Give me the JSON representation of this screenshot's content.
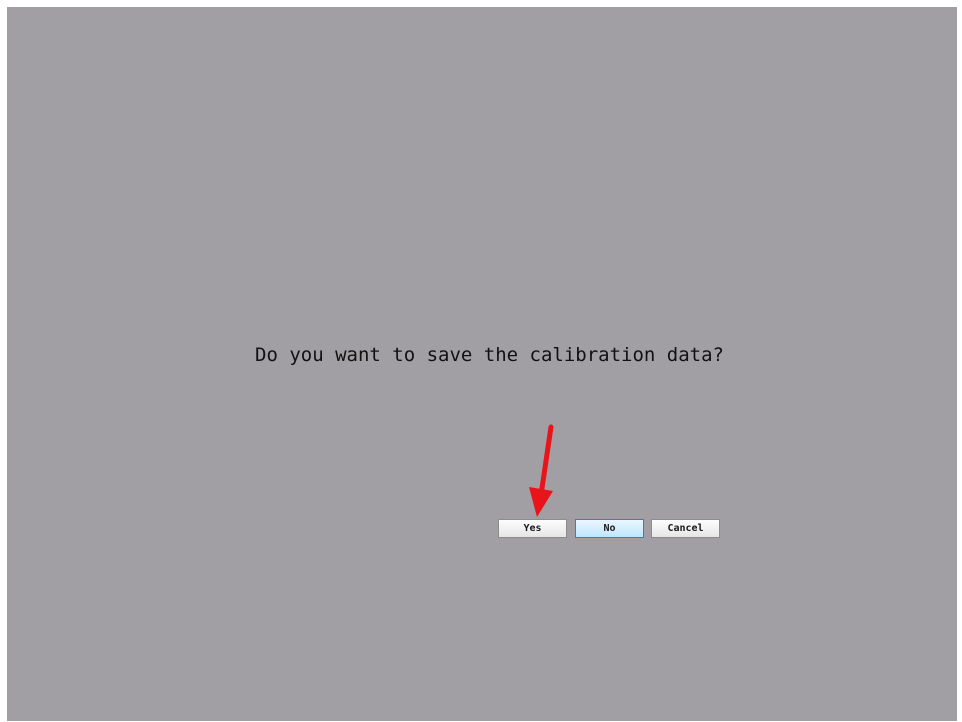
{
  "dialog": {
    "message": "Do you want to save the calibration data?",
    "buttons": {
      "yes": "Yes",
      "no": "No",
      "cancel": "Cancel"
    },
    "default_button": "No"
  },
  "colors": {
    "background": "#a19fa3",
    "annotation_arrow": "#e8141a"
  },
  "annotation": {
    "icon": "red-arrow-icon",
    "points_to": "Yes"
  }
}
